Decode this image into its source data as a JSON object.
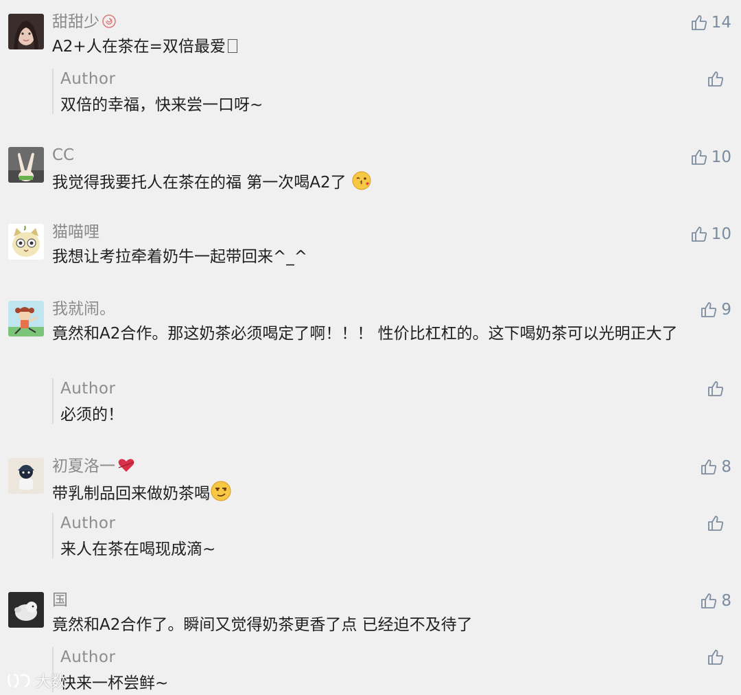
{
  "comments": [
    {
      "nickname": "甜甜少",
      "text": "A2+人在茶在=双倍最爱",
      "likes": "14",
      "reply": {
        "author": "Author",
        "text": "双倍的幸福，快来尝一口呀~"
      }
    },
    {
      "nickname": "CC",
      "text": "我觉得我要托人在茶在的福  第一次喝A2了",
      "likes": "10"
    },
    {
      "nickname": "猫喵哩",
      "text": "我想让考拉牵着奶牛一起带回来^_^",
      "likes": "10"
    },
    {
      "nickname": "我就闹。",
      "text": "竟然和A2合作。那这奶茶必须喝定了啊！！！ 性价比杠杠的。这下喝奶茶可以光明正大了",
      "likes": "9",
      "reply": {
        "author": "Author",
        "text": "必须的！"
      }
    },
    {
      "nickname": "初夏洛一",
      "text": "带乳制品回来做奶茶喝",
      "likes": "8",
      "reply": {
        "author": "Author",
        "text": "来人在茶在喝现成滴~"
      }
    },
    {
      "nickname": "国",
      "text": "竟然和A2合作了。瞬间又觉得奶茶更香了点  已经迫不及待了",
      "likes": "8",
      "reply": {
        "author": "Author",
        "text": "快来一杯尝鲜~"
      }
    }
  ],
  "watermark": {
    "text": "大数"
  },
  "icons": {
    "like": "thumbs-up-icon"
  },
  "colors": {
    "background": "#f0f0f0",
    "nickname": "#8a8a8a",
    "like": "#7b8c9e",
    "text": "#1f1f1f"
  }
}
